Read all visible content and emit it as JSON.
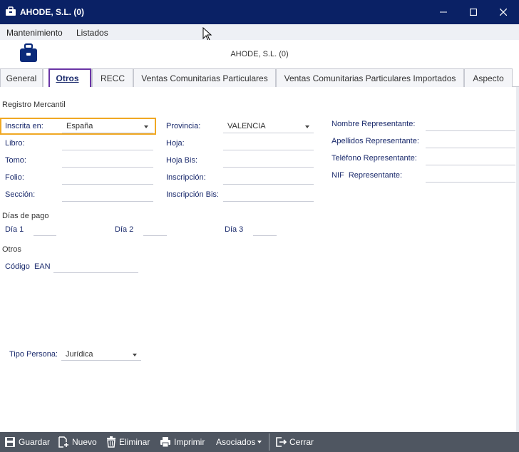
{
  "window": {
    "title": "AHODE, S.L. (0)",
    "controls": {
      "minimize": "—",
      "maximize": "☐",
      "close": "✕"
    }
  },
  "menu": {
    "items": [
      "Mantenimiento",
      "Listados"
    ]
  },
  "header": {
    "title": "AHODE, S.L. (0)"
  },
  "tabs": {
    "general": "General",
    "otros": "Otros",
    "recc": "RECC",
    "ventas_particulares": "Ventas Comunitarias Particulares",
    "ventas_importados": "Ventas Comunitarias Particulares Importados",
    "aspecto": "Aspecto",
    "active": "Otros"
  },
  "registro": {
    "section": "Registro Mercantil",
    "inscrita_label": "Inscrita en:",
    "inscrita_value": "España",
    "libro_label": "Libro:",
    "tomo_label": "Tomo:",
    "folio_label": "Folio:",
    "seccion_label": "Sección:",
    "provincia_label": "Provincia:",
    "provincia_value": "VALENCIA",
    "hoja_label": "Hoja:",
    "hoja_bis_label": "Hoja Bis:",
    "inscripcion_label": "Inscripción:",
    "inscripcion_bis_label": "Inscripción Bis:"
  },
  "representante": {
    "nombre_label": "Nombre Representante:",
    "apellidos_label": "Apellidos Representante:",
    "telefono_label": "Teléfono Representante:",
    "nif_label": "NIF  Representante:"
  },
  "dias_pago": {
    "section": "Días de pago",
    "dia1_label": "Día 1",
    "dia2_label": "Día 2",
    "dia3_label": "Día 3"
  },
  "otros": {
    "section": "Otros",
    "ean_label": "Código  EAN"
  },
  "tipo_persona": {
    "label": "Tipo Persona:",
    "value": "Jurídica"
  },
  "toolbar": {
    "guardar": "Guardar",
    "nuevo": "Nuevo",
    "eliminar": "Eliminar",
    "imprimir": "Imprimir",
    "asociados": "Asociados",
    "cerrar": "Cerrar"
  },
  "colors": {
    "titlebar": "#0a2165",
    "label_text": "#1a2a6c",
    "toolbar": "#4f5661",
    "highlight_orange": "#f0a823",
    "highlight_purple": "#6a35a6"
  }
}
